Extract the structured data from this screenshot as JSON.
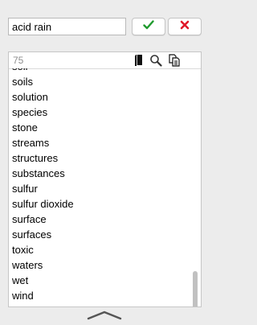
{
  "search": {
    "value": "acid rain"
  },
  "actions": {
    "ok_icon": "checkmark-icon",
    "ok_color": "#1f9a2d",
    "cancel_icon": "x-mark-icon",
    "cancel_color": "#e0182a"
  },
  "toolbar": {
    "count": "75",
    "icons": [
      "book-icon",
      "search-icon",
      "copy-icon"
    ]
  },
  "list": {
    "items": [
      "soil",
      "soils",
      "solution",
      "species",
      "stone",
      "streams",
      "structures",
      "substances",
      "sulfur",
      "sulfur dioxide",
      "surface",
      "surfaces",
      "toxic",
      "waters",
      "wet",
      "wind"
    ]
  },
  "footer": {
    "icon": "chevron-up-icon"
  }
}
